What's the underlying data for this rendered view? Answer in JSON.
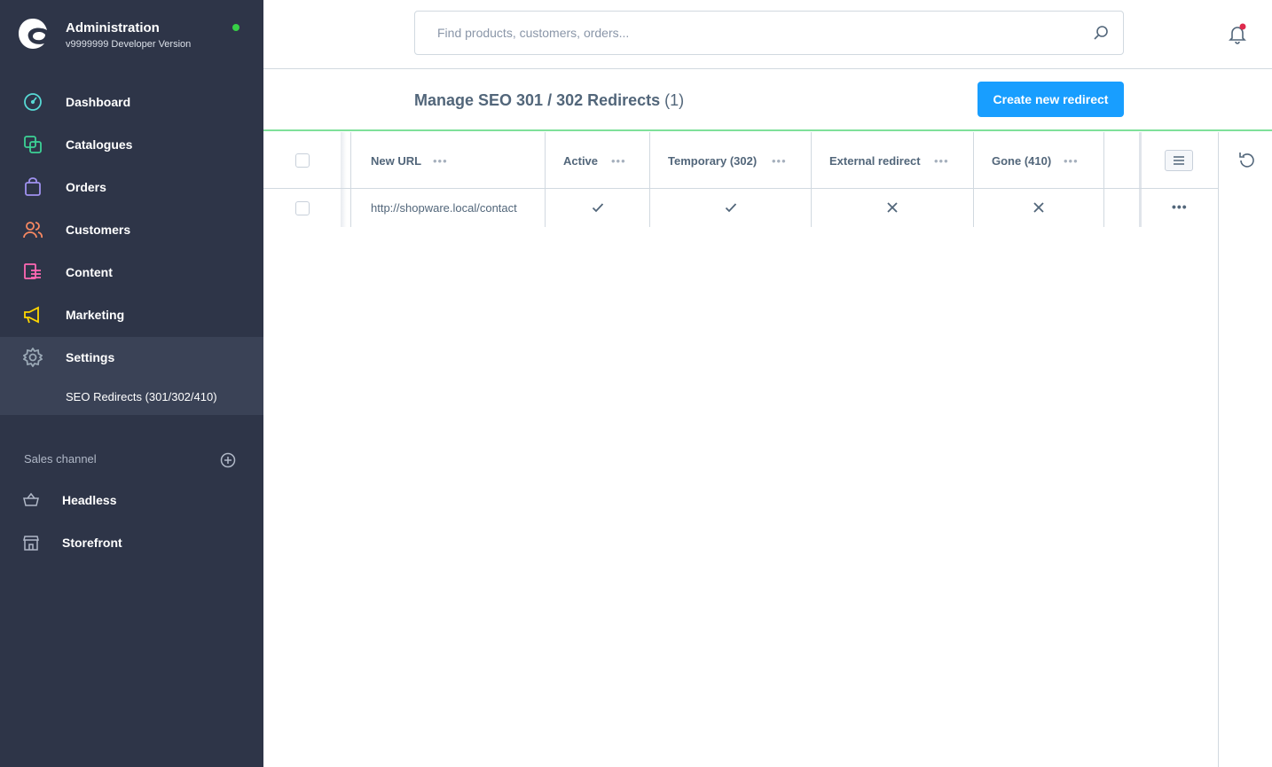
{
  "brand": {
    "title": "Administration",
    "version": "v9999999 Developer Version"
  },
  "nav": [
    {
      "label": "Dashboard",
      "icon": "dashboard-icon",
      "color": "#57d9d4"
    },
    {
      "label": "Catalogues",
      "icon": "catalogues-icon",
      "color": "#3cd195"
    },
    {
      "label": "Orders",
      "icon": "orders-icon",
      "color": "#a092f0"
    },
    {
      "label": "Customers",
      "icon": "customers-icon",
      "color": "#f88962"
    },
    {
      "label": "Content",
      "icon": "content-icon",
      "color": "#ff68b4"
    },
    {
      "label": "Marketing",
      "icon": "marketing-icon",
      "color": "#ffd700"
    },
    {
      "label": "Settings",
      "icon": "settings-icon",
      "color": "#9aa8b5"
    }
  ],
  "subnav": {
    "label": "SEO Redirects (301/302/410)"
  },
  "sales_channel": {
    "header": "Sales channel",
    "items": [
      {
        "label": "Headless",
        "icon": "basket-icon"
      },
      {
        "label": "Storefront",
        "icon": "storefront-icon"
      }
    ]
  },
  "search": {
    "placeholder": "Find products, customers, orders..."
  },
  "page": {
    "title": "Manage SEO 301 / 302 Redirects",
    "count": "(1)",
    "create_label": "Create new redirect"
  },
  "grid": {
    "columns": [
      "New URL",
      "Active",
      "Temporary (302)",
      "External redirect",
      "Gone (410)"
    ],
    "rows": [
      {
        "new_url": "http://shopware.local/contact",
        "active": "check",
        "temporary": "check",
        "external": "cross",
        "gone": "cross"
      }
    ]
  },
  "colors": {
    "accent": "#189eff",
    "sidebar": "#2e3548",
    "status_online": "#37d046",
    "notification": "#de294c"
  }
}
